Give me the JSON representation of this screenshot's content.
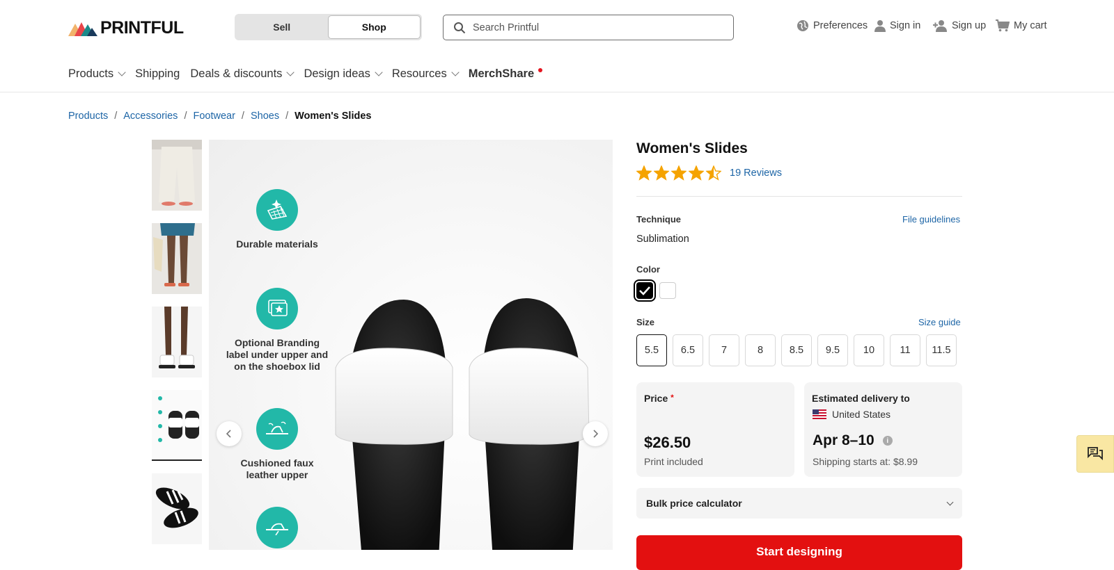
{
  "header": {
    "logo_text": "PRINTFUL",
    "toggle": {
      "sell": "Sell",
      "shop": "Shop"
    },
    "search": {
      "placeholder": "Search Printful"
    },
    "utils": {
      "preferences": "Preferences",
      "sign_in": "Sign in",
      "sign_up": "Sign up",
      "cart": "My cart"
    }
  },
  "nav": {
    "products": "Products",
    "shipping": "Shipping",
    "deals": "Deals & discounts",
    "design_ideas": "Design ideas",
    "resources": "Resources",
    "merchshare": "MerchShare"
  },
  "breadcrumb": [
    "Products",
    "Accessories",
    "Footwear",
    "Shoes",
    "Women's Slides"
  ],
  "gallery": {
    "features": [
      "Durable materials",
      "Optional Branding label under upper and on the shoebox lid",
      "Cushioned faux leather upper"
    ]
  },
  "product": {
    "title": "Women's Slides",
    "rating": 4.5,
    "reviews": "19 Reviews",
    "technique_label": "Technique",
    "file_guidelines": "File guidelines",
    "technique_value": "Sublimation",
    "color_label": "Color",
    "colors": [
      "#000000",
      "#ffffff"
    ],
    "size_label": "Size",
    "size_guide": "Size guide",
    "sizes": [
      "5.5",
      "6.5",
      "7",
      "8",
      "8.5",
      "9.5",
      "10",
      "11",
      "11.5"
    ],
    "price": {
      "label": "Price",
      "asterisk": "*",
      "value": "$26.50",
      "note": "Print included"
    },
    "delivery": {
      "label": "Estimated delivery to",
      "country": "United States",
      "dates": "Apr 8–10",
      "shipping": "Shipping starts at: $8.99"
    },
    "bulk": "Bulk price calculator",
    "cta": "Start designing"
  },
  "colors": {
    "accent_link": "#1d65a6",
    "teal": "#22b8a8",
    "cta_red": "#e31010",
    "star": "#f5a300"
  }
}
